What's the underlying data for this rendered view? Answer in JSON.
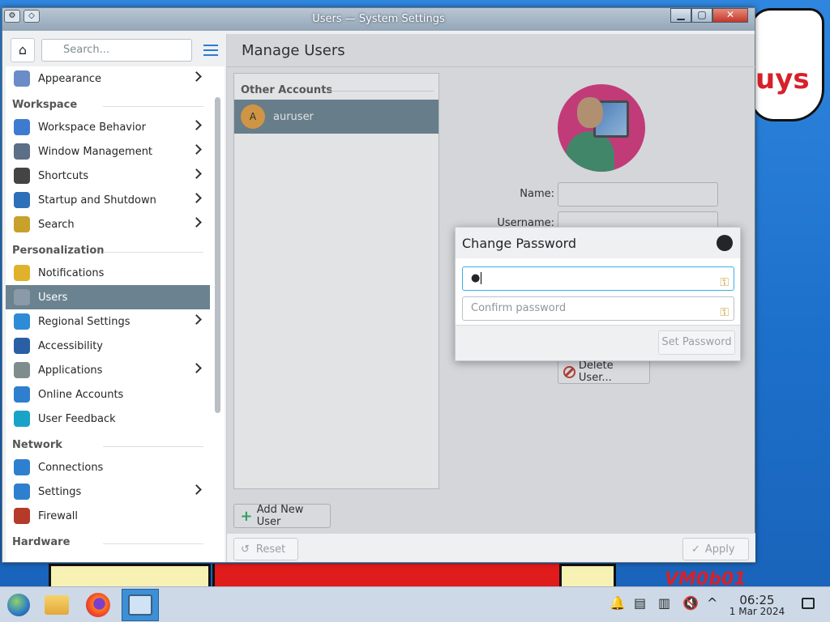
{
  "window": {
    "title": "Users — System Settings",
    "minimize_glyph": "▁",
    "maximize_glyph": "▢",
    "close_glyph": "✕"
  },
  "sidebar": {
    "search_placeholder": "Search...",
    "items": [
      {
        "type": "item",
        "label": "Appearance",
        "icon": "appearance-icon",
        "chevron": true
      },
      {
        "type": "section",
        "label": "Workspace"
      },
      {
        "type": "item",
        "label": "Workspace Behavior",
        "icon": "workspace-behavior-icon",
        "chevron": true
      },
      {
        "type": "item",
        "label": "Window Management",
        "icon": "window-management-icon",
        "chevron": true
      },
      {
        "type": "item",
        "label": "Shortcuts",
        "icon": "keyboard-icon",
        "chevron": true
      },
      {
        "type": "item",
        "label": "Startup and Shutdown",
        "icon": "startup-icon",
        "chevron": true
      },
      {
        "type": "item",
        "label": "Search",
        "icon": "search-icon",
        "chevron": true
      },
      {
        "type": "section",
        "label": "Personalization"
      },
      {
        "type": "item",
        "label": "Notifications",
        "icon": "bell-icon",
        "chevron": false
      },
      {
        "type": "item",
        "label": "Users",
        "icon": "users-icon",
        "chevron": false,
        "selected": true
      },
      {
        "type": "item",
        "label": "Regional Settings",
        "icon": "globe-icon",
        "chevron": true
      },
      {
        "type": "item",
        "label": "Accessibility",
        "icon": "accessibility-icon",
        "chevron": false
      },
      {
        "type": "item",
        "label": "Applications",
        "icon": "applications-icon",
        "chevron": true
      },
      {
        "type": "item",
        "label": "Online Accounts",
        "icon": "online-accounts-icon",
        "chevron": false
      },
      {
        "type": "item",
        "label": "User Feedback",
        "icon": "feedback-icon",
        "chevron": false
      },
      {
        "type": "section",
        "label": "Network"
      },
      {
        "type": "item",
        "label": "Connections",
        "icon": "connections-icon",
        "chevron": false
      },
      {
        "type": "item",
        "label": "Settings",
        "icon": "network-settings-icon",
        "chevron": true
      },
      {
        "type": "item",
        "label": "Firewall",
        "icon": "firewall-icon",
        "chevron": false
      },
      {
        "type": "section",
        "label": "Hardware"
      }
    ]
  },
  "main": {
    "title": "Manage Users",
    "accounts_header": "Other Accounts",
    "accounts": [
      {
        "initial": "A",
        "name": "auruser"
      }
    ],
    "add_user_label": "Add New User",
    "name_label": "Name:",
    "username_label": "Username:",
    "delete_user_label": "Delete User...",
    "reset_label": "Reset",
    "apply_label": "Apply"
  },
  "dialog": {
    "title": "Change Password",
    "password_value": "●",
    "confirm_placeholder": "Confirm password",
    "set_password_label": "Set Password"
  },
  "taskbar": {
    "time": "06:25",
    "date": "1 Mar 2024"
  },
  "wallpaper": {
    "text_top": "uys",
    "text_bottom": "VM0b01"
  },
  "colors": {
    "selection": "#6b8391",
    "accent": "#2b7bd1",
    "avatar_bg": "#d8337c",
    "account_avatar": "#e9a03c"
  }
}
